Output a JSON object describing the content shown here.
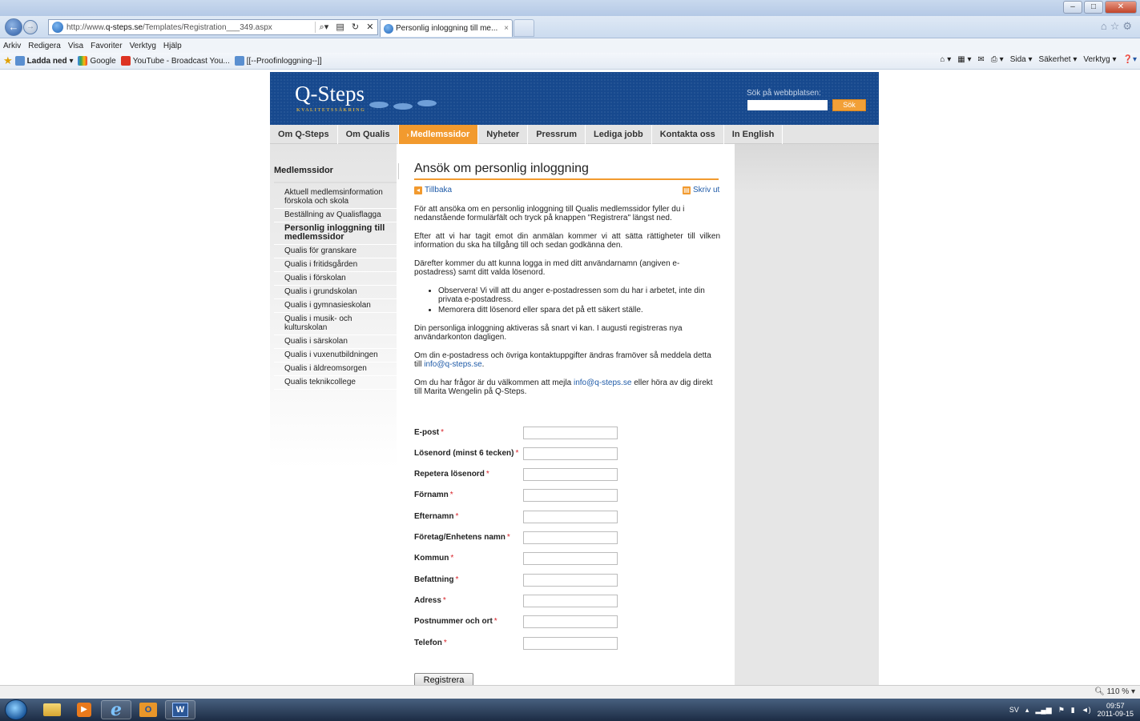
{
  "browser": {
    "url_prefix": "http://www.",
    "url_domain": "q-steps.se",
    "url_path": "/Templates/Registration___349.aspx",
    "tab_title": "Personlig inloggning till me...",
    "menu": [
      "Arkiv",
      "Redigera",
      "Visa",
      "Favoriter",
      "Verktyg",
      "Hjälp"
    ],
    "favorites": [
      "Ladda ned ▾",
      "Google",
      "YouTube - Broadcast You...",
      "[[--Proofinloggning--]]"
    ],
    "command_bar": [
      "Sida ▾",
      "Säkerhet ▾",
      "Verktyg ▾"
    ],
    "zoom": "110 %"
  },
  "header": {
    "logo": "Q-Steps",
    "logo_sub": "KVALITETSSÄKRING",
    "search_label": "Sök på webbplatsen:",
    "search_button": "Sök"
  },
  "topnav": [
    {
      "label": "Om Q-Steps",
      "active": false
    },
    {
      "label": "Om Qualis",
      "active": false
    },
    {
      "label": "Medlemssidor",
      "active": true
    },
    {
      "label": "Nyheter",
      "active": false
    },
    {
      "label": "Pressrum",
      "active": false
    },
    {
      "label": "Lediga jobb",
      "active": false
    },
    {
      "label": "Kontakta oss",
      "active": false
    },
    {
      "label": "In English",
      "active": false
    }
  ],
  "sidebar": {
    "heading": "Medlemssidor",
    "items": [
      {
        "label": "Aktuell medlemsinformation förskola och skola",
        "active": false
      },
      {
        "label": "Beställning av Qualisflagga",
        "active": false
      },
      {
        "label": "Personlig inloggning till medlemssidor",
        "active": true
      },
      {
        "label": "Qualis för granskare",
        "active": false
      },
      {
        "label": "Qualis i fritidsgården",
        "active": false
      },
      {
        "label": "Qualis i förskolan",
        "active": false
      },
      {
        "label": "Qualis i grundskolan",
        "active": false
      },
      {
        "label": "Qualis i gymnasieskolan",
        "active": false
      },
      {
        "label": "Qualis i musik- och kulturskolan",
        "active": false
      },
      {
        "label": "Qualis i särskolan",
        "active": false
      },
      {
        "label": "Qualis i vuxenutbildningen",
        "active": false
      },
      {
        "label": "Qualis i äldreomsorgen",
        "active": false
      },
      {
        "label": "Qualis teknikcollege",
        "active": false
      }
    ]
  },
  "main": {
    "title": "Ansök om personlig inloggning",
    "back_label": "Tillbaka",
    "print_label": "Skriv ut",
    "p1": "För att ansöka om en personlig inloggning till Qualis medlemssidor fyller du i nedanstående formulärfält och tryck på knappen \"Registrera\" längst ned.",
    "p2": "Efter att vi har tagit emot din anmälan kommer vi att sätta rättigheter till vilken information du ska ha tillgång till och sedan godkänna den.",
    "p3": "Därefter kommer du att kunna logga in med ditt användarnamn (angiven e-postadress) samt ditt valda lösenord.",
    "bullets": [
      "Observera! Vi vill att du anger e-postadressen som du har i arbetet, inte din privata e-postadress.",
      "Memorera ditt lösenord eller spara det på ett säkert ställe."
    ],
    "p4": "Din personliga inloggning aktiveras så snart vi kan. I augusti registreras nya användarkonton dagligen.",
    "p5_pre": "Om din e-postadress och övriga kontaktuppgifter ändras framöver så meddela detta till",
    "p5_link": "info@q-steps.se",
    "p5_post": ".",
    "p6_pre": "Om du har frågor är du välkommen att mejla",
    "p6_link": "info@q-steps.se",
    "p6_post": "eller höra av dig direkt till Marita Wengelin på Q-Steps.",
    "required_mark": "*",
    "fields": [
      {
        "label": "E-post",
        "value": ""
      },
      {
        "label": "Lösenord (minst 6 tecken)",
        "value": ""
      },
      {
        "label": "Repetera lösenord",
        "value": ""
      },
      {
        "label": "Förnamn",
        "value": ""
      },
      {
        "label": "Efternamn",
        "value": ""
      },
      {
        "label": "Företag/Enhetens namn",
        "value": ""
      },
      {
        "label": "Kommun",
        "value": ""
      },
      {
        "label": "Befattning",
        "value": ""
      },
      {
        "label": "Adress",
        "value": ""
      },
      {
        "label": "Postnummer och ort",
        "value": ""
      },
      {
        "label": "Telefon",
        "value": ""
      }
    ],
    "submit_label": "Registrera"
  },
  "taskbar": {
    "lang": "SV",
    "time": "09:57",
    "date": "2011-09-15"
  },
  "colors": {
    "header_blue": "#17498e",
    "accent_orange": "#f29a2e",
    "link_blue": "#1f5ba8",
    "required_red": "#d9232a"
  }
}
